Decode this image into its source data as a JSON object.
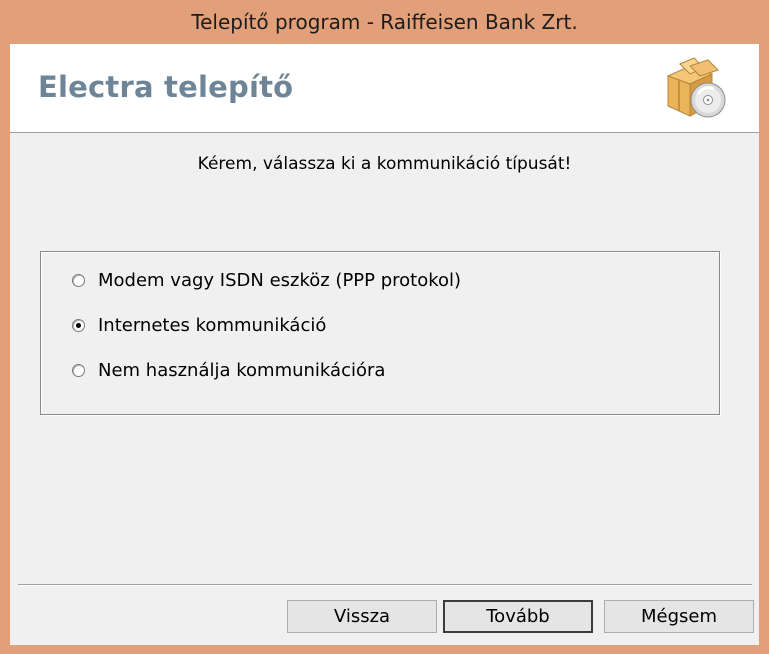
{
  "window": {
    "title": "Telepítő program - Raiffeisen Bank Zrt.",
    "frame_color": "#e1a07a"
  },
  "header": {
    "title": "Electra telepítő",
    "title_color": "#6e8598",
    "icon": "package-cd-icon"
  },
  "prompt": "Kérem, válassza ki a kommunikáció típusát!",
  "options": [
    {
      "label": "Modem vagy ISDN eszköz (PPP protokol)",
      "checked": false
    },
    {
      "label": "Internetes kommunikáció",
      "checked": true
    },
    {
      "label": "Nem használja kommunikációra",
      "checked": false
    }
  ],
  "buttons": {
    "back": "Vissza",
    "next": "Tovább",
    "cancel": "Mégsem"
  }
}
